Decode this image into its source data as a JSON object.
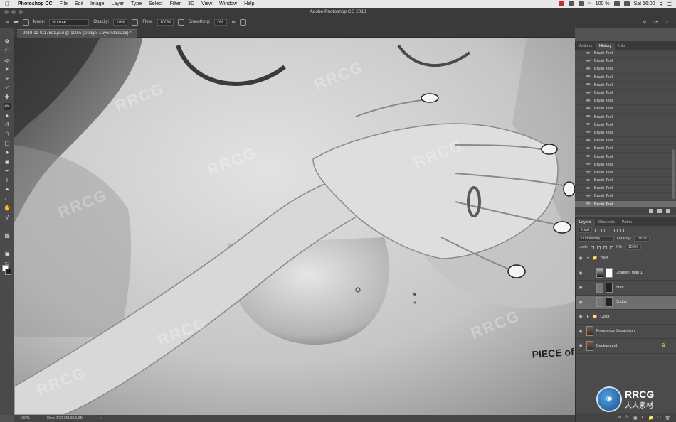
{
  "menubar": {
    "apple": "",
    "app": "Photoshop CC",
    "items": [
      "File",
      "Edit",
      "Image",
      "Layer",
      "Type",
      "Select",
      "Filter",
      "3D",
      "View",
      "Window",
      "Help"
    ],
    "battery": "100 %",
    "clock": "Sat 16:00"
  },
  "window": {
    "title": "Adobe Photoshop CC 2018"
  },
  "options": {
    "mode_label": "Mode:",
    "mode_value": "Normal",
    "opacity_label": "Opacity:",
    "opacity_value": "10%",
    "flow_label": "Flow:",
    "flow_value": "100%",
    "smoothing_label": "Smoothing:",
    "smoothing_value": "0%"
  },
  "document": {
    "tab_title": "2019-11-01178e1.psd @ 100% (Dodge, Layer Mask/16) *"
  },
  "canvas": {
    "tattoo": "PIECE of ME"
  },
  "status": {
    "zoom": "100%",
    "doc": "Doc: 172,3M/358,9M"
  },
  "history": {
    "tabs": [
      "Actions",
      "History",
      "Info"
    ],
    "active_tab": "History",
    "items": [
      "Brush Tool",
      "Brush Tool",
      "Brush Tool",
      "Brush Tool",
      "Brush Tool",
      "Brush Tool",
      "Brush Tool",
      "Brush Tool",
      "Brush Tool",
      "Brush Tool",
      "Brush Tool",
      "Brush Tool",
      "Brush Tool",
      "Brush Tool",
      "Brush Tool",
      "Brush Tool",
      "Brush Tool",
      "Brush Tool",
      "Brush Tool",
      "Brush Tool"
    ]
  },
  "layers_panel": {
    "tabs": [
      "Layers",
      "Channels",
      "Paths"
    ],
    "active_tab": "Layers",
    "filter": "Kind",
    "blend_mode": "Luminosity",
    "opacity_label": "Opacity:",
    "opacity_value": "100%",
    "lock_label": "Lock:",
    "fill_label": "Fill:",
    "fill_value": "100%",
    "layers": [
      {
        "name": "D&B",
        "kind": "group",
        "selected": false
      },
      {
        "name": "Gradient Map 1",
        "kind": "adjustment",
        "selected": false
      },
      {
        "name": "Burn",
        "kind": "layer",
        "selected": false
      },
      {
        "name": "Dodge",
        "kind": "layer",
        "selected": true
      },
      {
        "name": "Color",
        "kind": "group",
        "selected": false
      },
      {
        "name": "Frequency Separation",
        "kind": "smart",
        "selected": false
      },
      {
        "name": "Background",
        "kind": "photo",
        "selected": false
      }
    ]
  },
  "watermark": {
    "text": "RRCG",
    "logo_main": "RRCG",
    "logo_sub": "人人素材"
  },
  "colors": {
    "app_bg": "#535353",
    "panel_bg": "#4b4b4b",
    "selected_row": "#6e6e6e",
    "menubar_bg": "#e8e8e8"
  }
}
